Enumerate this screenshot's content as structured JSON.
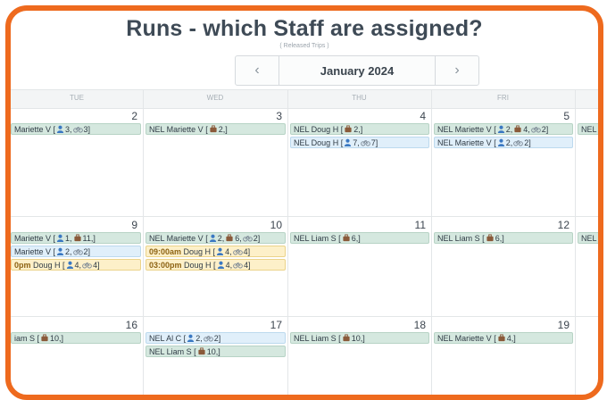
{
  "title": "Runs - which Staff are assigned?",
  "subtitle": "( Released Trips )",
  "nav": {
    "month": "January 2024",
    "prev_icon": "chevron-left-icon",
    "next_icon": "chevron-right-icon"
  },
  "colors": {
    "frame": "#ee6a1e",
    "event_green": "#d5e8df",
    "event_blue": "#e0effa",
    "event_yellow": "#fdf0c9"
  },
  "days": [
    "TUE",
    "WED",
    "THU",
    "FRI"
  ],
  "weeks": [
    {
      "dates": [
        "2",
        "3",
        "4",
        "5"
      ],
      "events": [
        [
          {
            "color": "green",
            "segs": [
              {
                "t": "Mariette V ["
              },
              {
                "i": "person",
                "n": "3,"
              },
              {
                "i": "bike",
                "n": "3]"
              }
            ]
          }
        ],
        [
          {
            "color": "green",
            "segs": [
              {
                "t": "NEL Mariette V ["
              },
              {
                "i": "bag",
                "n": "2,]"
              }
            ]
          }
        ],
        [
          {
            "color": "green",
            "segs": [
              {
                "t": "NEL Doug H ["
              },
              {
                "i": "bag",
                "n": "2,]"
              }
            ]
          },
          {
            "color": "blue",
            "segs": [
              {
                "t": "NEL Doug H ["
              },
              {
                "i": "person",
                "n": "7,"
              },
              {
                "i": "bike",
                "n": "7]"
              }
            ]
          }
        ],
        [
          {
            "color": "green",
            "segs": [
              {
                "t": "NEL Mariette V ["
              },
              {
                "i": "person",
                "n": "2,"
              },
              {
                "i": "bag",
                "n": "4,"
              },
              {
                "i": "bike",
                "n": "2]"
              }
            ]
          },
          {
            "color": "blue",
            "segs": [
              {
                "t": "NEL Mariette V ["
              },
              {
                "i": "person",
                "n": "2,"
              },
              {
                "i": "bike",
                "n": "2]"
              }
            ]
          }
        ],
        [
          {
            "color": "green",
            "segs": [
              {
                "t": "NEL A"
              }
            ]
          }
        ]
      ]
    },
    {
      "dates": [
        "9",
        "10",
        "11",
        "12"
      ],
      "events": [
        [
          {
            "color": "green",
            "segs": [
              {
                "t": "Mariette V ["
              },
              {
                "i": "person",
                "n": "1,"
              },
              {
                "i": "bag",
                "n": "11,]"
              }
            ]
          },
          {
            "color": "blue",
            "segs": [
              {
                "t": "Mariette V ["
              },
              {
                "i": "person",
                "n": "2,"
              },
              {
                "i": "bike",
                "n": "2]"
              }
            ]
          },
          {
            "color": "yellow",
            "segs": [
              {
                "b": "0pm"
              },
              {
                "t": " Doug H ["
              },
              {
                "i": "person",
                "n": "4,"
              },
              {
                "i": "bike",
                "n": "4]"
              }
            ]
          }
        ],
        [
          {
            "color": "green",
            "segs": [
              {
                "t": "NEL Mariette V ["
              },
              {
                "i": "person",
                "n": "2,"
              },
              {
                "i": "bag",
                "n": "6,"
              },
              {
                "i": "bike",
                "n": "2]"
              }
            ]
          },
          {
            "color": "yellow",
            "segs": [
              {
                "b": "09:00am"
              },
              {
                "t": " Doug H ["
              },
              {
                "i": "person",
                "n": "4,"
              },
              {
                "i": "bike",
                "n": "4]"
              }
            ]
          },
          {
            "color": "yellow",
            "segs": [
              {
                "b": "03:00pm"
              },
              {
                "t": " Doug H ["
              },
              {
                "i": "person",
                "n": "4,"
              },
              {
                "i": "bike",
                "n": "4]"
              }
            ]
          }
        ],
        [
          {
            "color": "green",
            "segs": [
              {
                "t": "NEL Liam S ["
              },
              {
                "i": "bag",
                "n": "6,]"
              }
            ]
          }
        ],
        [
          {
            "color": "green",
            "segs": [
              {
                "t": "NEL Liam S ["
              },
              {
                "i": "bag",
                "n": "6,]"
              }
            ]
          }
        ],
        [
          {
            "color": "green",
            "segs": [
              {
                "t": "NEL A"
              }
            ]
          }
        ]
      ]
    },
    {
      "dates": [
        "16",
        "17",
        "18",
        "19"
      ],
      "events": [
        [
          {
            "color": "green",
            "segs": [
              {
                "t": "iam S ["
              },
              {
                "i": "bag",
                "n": "10,]"
              }
            ]
          }
        ],
        [
          {
            "color": "blue",
            "segs": [
              {
                "t": "NEL Al C ["
              },
              {
                "i": "person",
                "n": "2,"
              },
              {
                "i": "bike",
                "n": "2]"
              }
            ]
          },
          {
            "color": "green",
            "segs": [
              {
                "t": "NEL Liam S ["
              },
              {
                "i": "bag",
                "n": "10,]"
              }
            ]
          }
        ],
        [
          {
            "color": "green",
            "segs": [
              {
                "t": "NEL Liam S ["
              },
              {
                "i": "bag",
                "n": "10,]"
              }
            ]
          }
        ],
        [
          {
            "color": "green",
            "segs": [
              {
                "t": "NEL Mariette V ["
              },
              {
                "i": "bag",
                "n": "4,]"
              }
            ]
          }
        ],
        []
      ]
    }
  ]
}
